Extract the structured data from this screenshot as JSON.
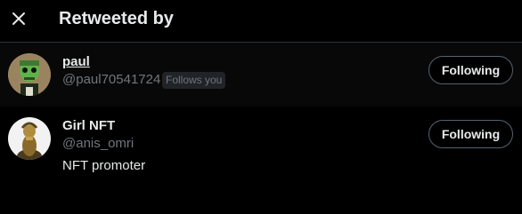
{
  "header": {
    "title": "Retweeted by",
    "close_icon": "close-icon"
  },
  "users": [
    {
      "name": "paul",
      "handle": "@paul70541724",
      "badge": "Follows you",
      "button_label": "Following",
      "avatar": "green-zombie-avatar"
    },
    {
      "name": "Girl NFT",
      "handle": "@anis_omri",
      "bio": "NFT promoter",
      "button_label": "Following",
      "avatar": "gold-figure-avatar"
    }
  ],
  "colors": {
    "background": "#000000",
    "text_primary": "#e7e9ea",
    "text_secondary": "#71767b",
    "divider": "#2f3336",
    "button_border": "#536471",
    "badge_background": "#202327"
  }
}
